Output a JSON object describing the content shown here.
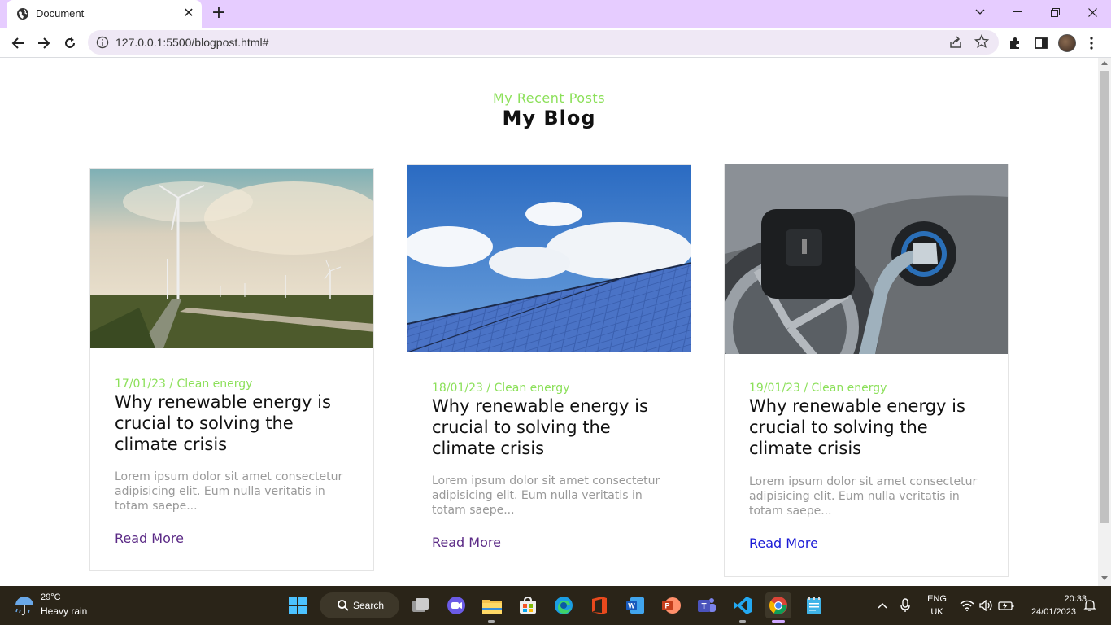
{
  "browser": {
    "tab_title": "Document",
    "url": "127.0.0.1:5500/blogpost.html#"
  },
  "page": {
    "subtitle": "My Recent Posts",
    "title": "My Blog"
  },
  "posts": [
    {
      "meta": "17/01/23 / Clean energy",
      "title": "Why renewable energy is crucial to solving the climate crisis",
      "excerpt": "Lorem ipsum dolor sit amet consectetur adipisicing elit. Eum nulla veritatis in totam saepe...",
      "link_label": "Read More",
      "link_color": "#5b2a86",
      "image": "wind-turbines-image"
    },
    {
      "meta": "18/01/23 / Clean energy",
      "title": "Why renewable energy is crucial to solving the climate crisis",
      "excerpt": "Lorem ipsum dolor sit amet consectetur adipisicing elit. Eum nulla veritatis in totam saepe...",
      "link_label": "Read More",
      "link_color": "#5b2a86",
      "image": "solar-panel-image"
    },
    {
      "meta": "19/01/23 / Clean energy",
      "title": "Why renewable energy is crucial to solving the climate crisis",
      "excerpt": "Lorem ipsum dolor sit amet consectetur adipisicing elit. Eum nulla veritatis in totam saepe...",
      "link_label": "Read More",
      "link_color": "#1a1ad6",
      "image": "ev-charging-image"
    }
  ],
  "colors": {
    "accent_green": "#8ce05a",
    "tab_strip": "#e6ccff",
    "taskbar": "#2a2418"
  },
  "taskbar": {
    "weather_temp": "29°C",
    "weather_desc": "Heavy rain",
    "search_label": "Search",
    "lang_top": "ENG",
    "lang_bottom": "UK",
    "time": "20:33",
    "date": "24/01/2023"
  }
}
